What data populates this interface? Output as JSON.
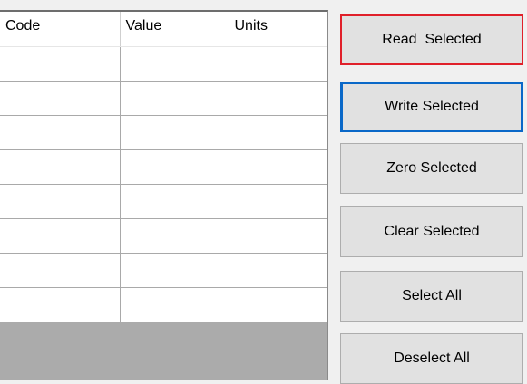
{
  "table": {
    "columns": [
      "Code",
      "Value",
      "Units"
    ],
    "rows": [
      [
        "",
        "",
        ""
      ],
      [
        "",
        "",
        ""
      ],
      [
        "",
        "",
        ""
      ],
      [
        "",
        "",
        ""
      ],
      [
        "",
        "",
        ""
      ],
      [
        "",
        "",
        ""
      ],
      [
        "",
        "",
        ""
      ],
      [
        "",
        "",
        ""
      ]
    ]
  },
  "buttons": {
    "read_selected": "Read  Selected",
    "write_selected": "Write Selected",
    "zero_selected": "Zero Selected",
    "clear_selected": "Clear Selected",
    "select_all": "Select All",
    "deselect_all": "Deselect All"
  },
  "colors": {
    "highlight_red": "#e0202a",
    "focus_blue": "#0a68c8",
    "button_face": "#e1e1e1",
    "grid_empty_area": "#ababab"
  }
}
